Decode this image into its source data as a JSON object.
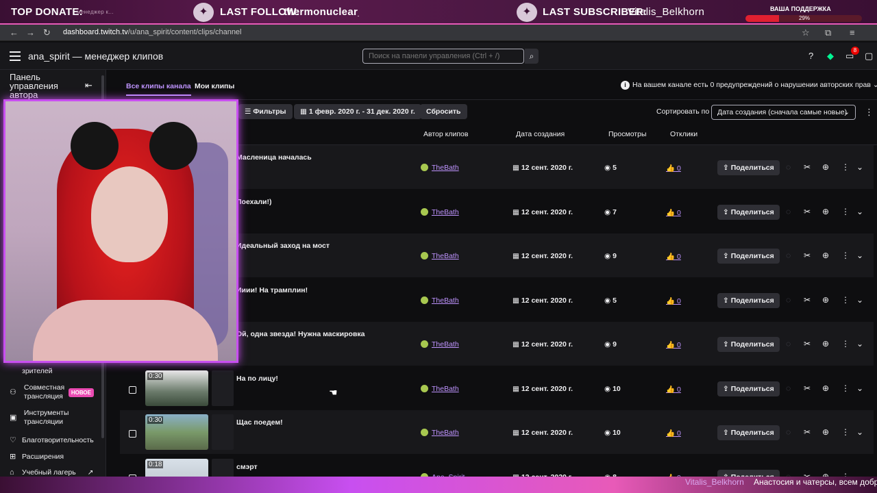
{
  "overlay": {
    "top_donate": "TOP DONATE:",
    "tab_ghost": "менеджер к...",
    "last_follow_label": "LAST FOLLOW:",
    "last_follow_name": "thermonuclear_r",
    "last_subscriber_label": "LAST SUBSCRIBER:",
    "last_subscriber_name": "Vitalis_Belkhorn",
    "support_label": "ВАША ПОДДЕРЖКА",
    "support_percent": "29%",
    "support_fraction": 0.29,
    "chat_name": "Vitalis_Belkhorn",
    "chat_text": "Анастосия и чатерсы, всем добр"
  },
  "browser": {
    "url_host": "dashboard.twitch.tv",
    "url_path": "/u/ana_spirit/content/clips/channel"
  },
  "header": {
    "title": "ana_spirit — менеджер клипов",
    "search_placeholder": "Поиск на панели управления (Ctrl + /)",
    "notifications_count": "8"
  },
  "sidebar": {
    "title": "Панель управления автора",
    "items": [
      {
        "label": "зрителей",
        "icon": "users-icon"
      },
      {
        "label": "Совместная трансляция",
        "icon": "collab-icon",
        "badge": "НОВОЕ"
      },
      {
        "label": "Инструменты трансляции",
        "icon": "tools-icon"
      },
      {
        "label": "Благотворительность",
        "icon": "heart-icon"
      },
      {
        "label": "Расширения",
        "icon": "puzzle-icon"
      },
      {
        "label": "Учебный лагерь",
        "icon": "camp-icon"
      }
    ]
  },
  "main": {
    "tabs": [
      "Все клипы канала",
      "Мои клипы"
    ],
    "copyright_notice": "На вашем канале есть 0 предупреждений о нарушении авторских прав",
    "filters_label": "Фильтры",
    "date_range": "1 февр. 2020 г. - 31 дек. 2020 г.",
    "reset_label": "Сбросить",
    "sort_label": "Сортировать по",
    "sort_value": "Дата создания (сначала самые новые)",
    "columns": {
      "author": "Автор клипов",
      "date": "Дата создания",
      "views": "Просмотры",
      "responses": "Отклики"
    },
    "share_label": "Поделиться",
    "clips": [
      {
        "title": "Масленица началась",
        "author": "TheBath",
        "date": "12 сент. 2020 г.",
        "views": "5",
        "likes": "0",
        "duration": ""
      },
      {
        "title": "Поехали!)",
        "author": "TheBath",
        "date": "12 сент. 2020 г.",
        "views": "7",
        "likes": "0",
        "duration": ""
      },
      {
        "title": "Идеальный заход на мост",
        "author": "TheBath",
        "date": "12 сент. 2020 г.",
        "views": "9",
        "likes": "0",
        "duration": ""
      },
      {
        "title": "Ииии! На трамплин!",
        "author": "TheBath",
        "date": "12 сент. 2020 г.",
        "views": "5",
        "likes": "0",
        "duration": ""
      },
      {
        "title": "Ой, одна звезда! Нужна маскировка",
        "author": "TheBath",
        "date": "12 сент. 2020 г.",
        "views": "9",
        "likes": "0",
        "duration": ""
      },
      {
        "title": "На по лицу!",
        "author": "TheBath",
        "date": "12 сент. 2020 г.",
        "views": "10",
        "likes": "0",
        "duration": "0:30"
      },
      {
        "title": "Щас поедем!",
        "author": "TheBath",
        "date": "12 сент. 2020 г.",
        "views": "10",
        "likes": "0",
        "duration": "0:30"
      },
      {
        "title": "смэрт",
        "author": "Ana_Spirit",
        "date": "12 сент. 2020 г.",
        "views": "8",
        "likes": "0",
        "duration": "0:18"
      }
    ]
  },
  "colors": {
    "accent": "#bf94ff",
    "overlay_pink": "#e85ab8",
    "cam_border": "#c84ff0",
    "bg": "#0e0e10",
    "surface": "#18181b"
  }
}
